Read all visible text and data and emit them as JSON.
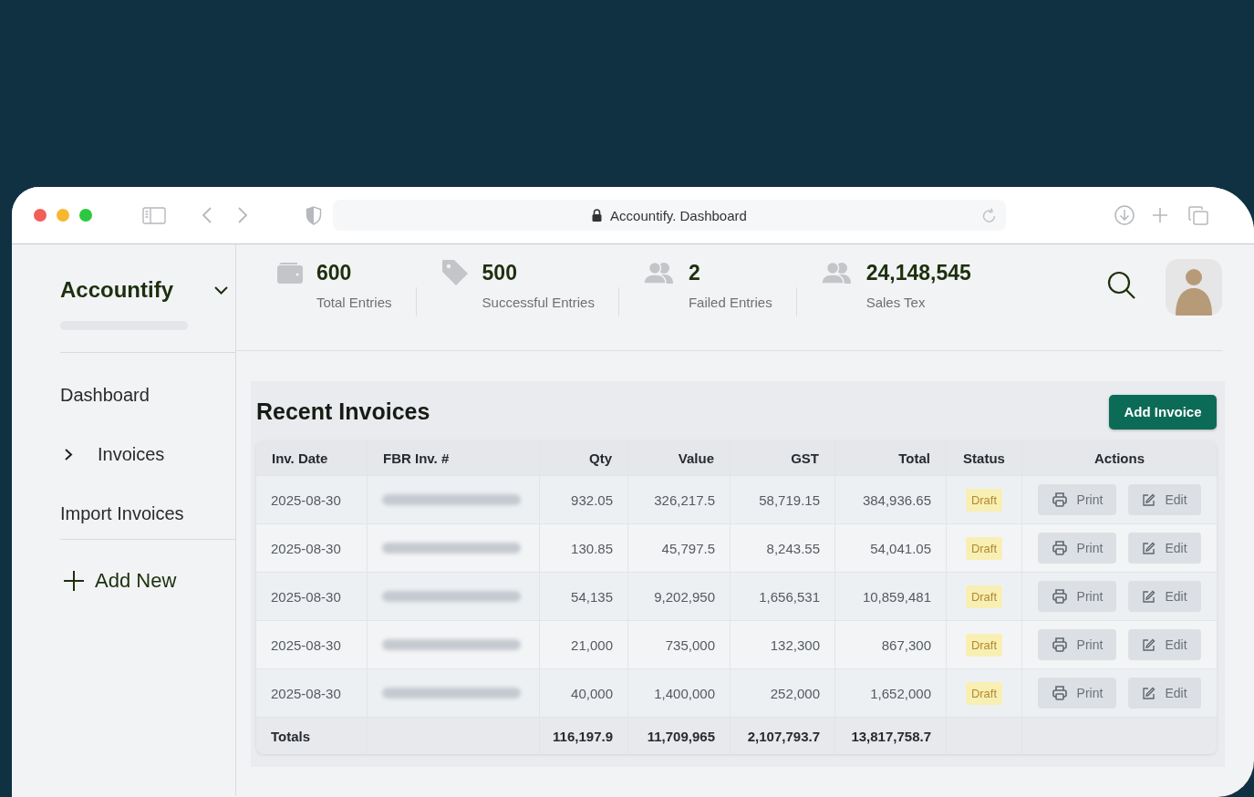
{
  "browser": {
    "address": "Accountify. Dashboard"
  },
  "sidebar": {
    "brand": "Accountify",
    "items": [
      {
        "label": "Dashboard",
        "kind": "link"
      },
      {
        "label": "Invoices",
        "kind": "group",
        "expanded": false
      },
      {
        "label": "Import Invoices",
        "kind": "link"
      }
    ],
    "add_new": "Add New"
  },
  "stats": [
    {
      "kind": "wallet",
      "value": "600",
      "label": "Total Entries"
    },
    {
      "kind": "tag",
      "value": "500",
      "label": "Successful Entries"
    },
    {
      "kind": "users",
      "value": "2",
      "label": "Failed Entries"
    },
    {
      "kind": "users",
      "value": "24,148,545",
      "label": "Sales Tex"
    }
  ],
  "invoices": {
    "title": "Recent Invoices",
    "add_button": "Add Invoice",
    "columns": [
      "Inv. Date",
      "FBR Inv. #",
      "Qty",
      "Value",
      "GST",
      "Total",
      "Status",
      "Actions"
    ],
    "rows": [
      {
        "date": "2025-08-30",
        "qty": "932.05",
        "value": "326,217.5",
        "gst": "58,719.15",
        "total": "384,936.65",
        "status": "Draft",
        "actions": [
          {
            "kind": "print",
            "label": "Print"
          },
          {
            "kind": "edit",
            "label": "Edit"
          }
        ]
      },
      {
        "date": "2025-08-30",
        "qty": "130.85",
        "value": "45,797.5",
        "gst": "8,243.55",
        "total": "54,041.05",
        "status": "Draft",
        "actions": [
          {
            "kind": "print",
            "label": "Print"
          },
          {
            "kind": "edit",
            "label": "Edit"
          }
        ]
      },
      {
        "date": "2025-08-30",
        "qty": "54,135",
        "value": "9,202,950",
        "gst": "1,656,531",
        "total": "10,859,481",
        "status": "Draft",
        "actions": [
          {
            "kind": "print",
            "label": "Print"
          },
          {
            "kind": "edit",
            "label": "Edit"
          }
        ]
      },
      {
        "date": "2025-08-30",
        "qty": "21,000",
        "value": "735,000",
        "gst": "132,300",
        "total": "867,300",
        "status": "Draft",
        "actions": [
          {
            "kind": "print",
            "label": "Print"
          },
          {
            "kind": "edit",
            "label": "Edit"
          }
        ]
      },
      {
        "date": "2025-08-30",
        "qty": "40,000",
        "value": "1,400,000",
        "gst": "252,000",
        "total": "1,652,000",
        "status": "Draft",
        "actions": [
          {
            "kind": "print",
            "label": "Print"
          },
          {
            "kind": "edit",
            "label": "Edit"
          }
        ]
      }
    ],
    "totals": {
      "label": "Totals",
      "qty": "116,197.9",
      "value": "11,709,965",
      "gst": "2,107,793.7",
      "total": "13,817,758.7"
    }
  }
}
